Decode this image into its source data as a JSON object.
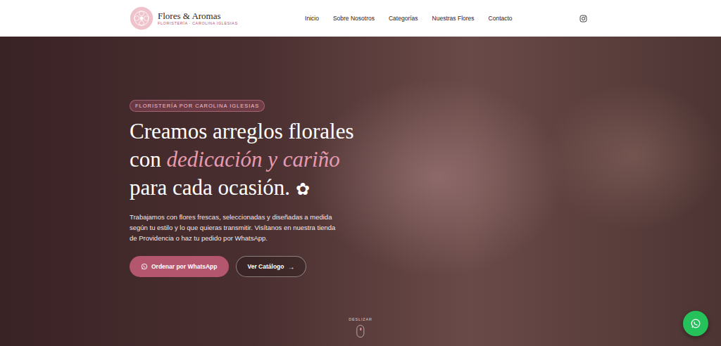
{
  "header": {
    "logo": {
      "title": "Flores & Aromas",
      "subtitle": "FLORISTERÍA · CAROLINA IGLESIAS"
    },
    "nav": [
      {
        "label": "Inicio"
      },
      {
        "label": "Sobre Nosotros"
      },
      {
        "label": "Categorías"
      },
      {
        "label": "Nuestras Flores"
      },
      {
        "label": "Contacto"
      }
    ]
  },
  "hero": {
    "badge": "FLORISTERÍA POR CAROLINA IGLESIAS",
    "heading": {
      "line1": "Creamos arreglos florales",
      "line2_start": "con",
      "emphasis": "dedicación y cariño",
      "line3": "para cada ocasión.",
      "glyph": "✿"
    },
    "description": "Trabajamos con flores frescas, seleccionadas y diseñadas a medida según tu estilo y lo que quieras transmitir. Visítanos en nuestra tienda de Providencia o haz tu pedido por WhatsApp.",
    "buttons": [
      {
        "label": "Ordenar por WhatsApp",
        "kind": "primary"
      },
      {
        "label": "Ver Catálogo",
        "kind": "secondary",
        "arrow": "→"
      }
    ],
    "scroll_hint": "DESLIZAR"
  }
}
